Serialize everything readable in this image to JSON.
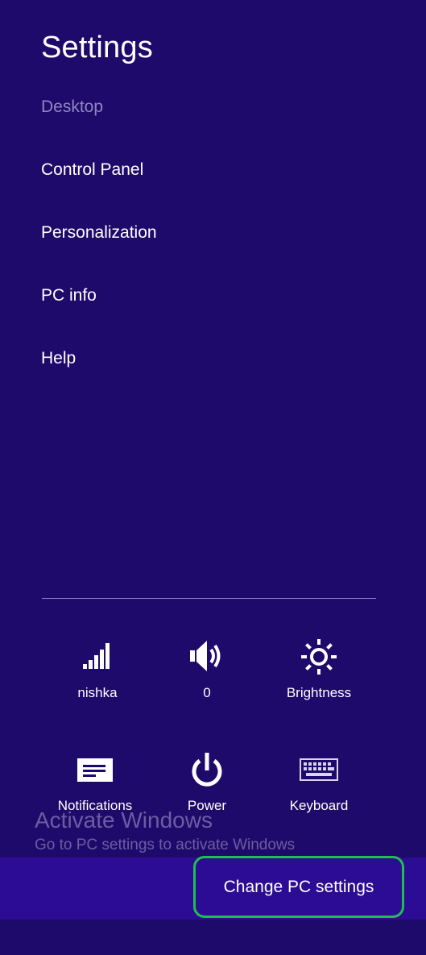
{
  "panel": {
    "title": "Settings",
    "menu": [
      {
        "label": "Desktop",
        "enabled": false
      },
      {
        "label": "Control Panel",
        "enabled": true
      },
      {
        "label": "Personalization",
        "enabled": true
      },
      {
        "label": "PC info",
        "enabled": true
      },
      {
        "label": "Help",
        "enabled": true
      }
    ]
  },
  "quick_settings": {
    "network": {
      "label": "nishka",
      "icon": "signal-bars-icon"
    },
    "volume": {
      "label": "0",
      "icon": "speaker-icon"
    },
    "brightness": {
      "label": "Brightness",
      "icon": "sun-icon"
    },
    "notifications": {
      "label": "Notifications",
      "icon": "notifications-icon"
    },
    "power": {
      "label": "Power",
      "icon": "power-icon"
    },
    "keyboard": {
      "label": "Keyboard",
      "icon": "keyboard-icon"
    }
  },
  "watermark": {
    "title": "Activate Windows",
    "subtitle": "Go to PC settings to activate Windows"
  },
  "footer": {
    "change_pc_settings": "Change PC settings"
  },
  "colors": {
    "background": "#1e0a6b",
    "bottom_bar": "#2c0c94",
    "highlight_border": "#1fbf4e",
    "disabled_text": "#8f86c2"
  }
}
